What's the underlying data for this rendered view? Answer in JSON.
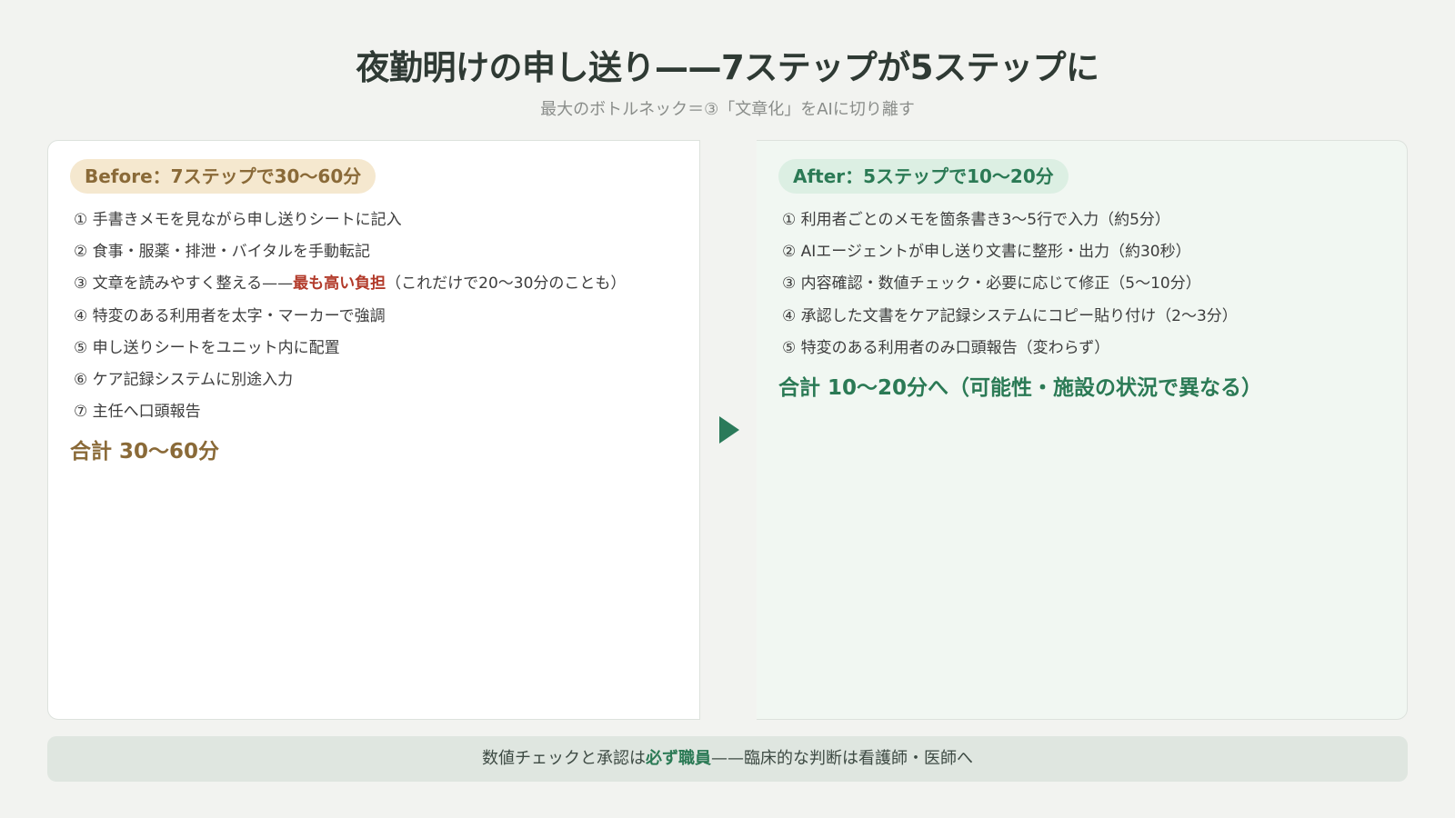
{
  "header": {
    "title": "夜勤明けの申し送り——7ステップが5ステップに",
    "subtitle": "最大のボトルネック＝③「文章化」をAIに切り離す"
  },
  "before": {
    "label": "Before：7ステップで30〜60分",
    "steps": [
      "① 手書きメモを見ながら申し送りシートに記入",
      "② 食事・服薬・排泄・バイタルを手動転記",
      "③ 文章を読みやすく整える——",
      "④ 特変のある利用者を太字・マーカーで強調",
      "⑤ 申し送りシートをユニット内に配置",
      "⑥ ケア記録システムに別途入力",
      "⑦ 主任へ口頭報告"
    ],
    "step3_highlight": "最も高い負担",
    "step3_note": "（これだけで20〜30分のことも）",
    "total": "合計 30〜60分"
  },
  "after": {
    "label": "After：5ステップで10〜20分",
    "steps": [
      "① 利用者ごとのメモを箇条書き3〜5行で入力（約5分）",
      "② AIエージェントが申し送り文書に整形・出力（約30秒）",
      "③ 内容確認・数値チェック・必要に応じて修正（5〜10分）",
      "④ 承認した文書をケア記録システムにコピー貼り付け（2〜3分）",
      "⑤ 特変のある利用者のみ口頭報告（変わらず）"
    ],
    "total": "合計 10〜20分へ（可能性・施設の状況で異なる）"
  },
  "footer": {
    "prefix": "数値チェックと承認は",
    "emphasis": "必ず職員",
    "suffix": "——臨床的な判断は看護師・医師へ"
  },
  "colors": {
    "before_accent": "#8a6a38",
    "after_accent": "#2b7a55",
    "highlight": "#b23a2a"
  }
}
